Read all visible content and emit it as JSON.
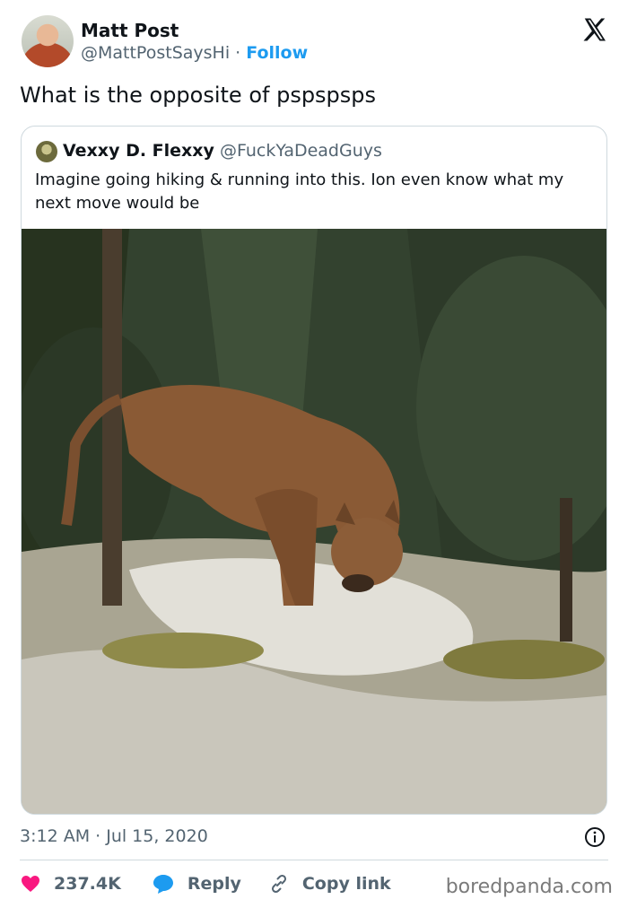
{
  "author": {
    "name": "Matt Post",
    "handle": "@MattPostSaysHi",
    "separator": "·",
    "follow_label": "Follow"
  },
  "tweet_text": "What is the opposite of pspspsps",
  "quoted": {
    "name": "Vexxy D. Flexxy",
    "handle": "@FuckYaDeadGuys",
    "text": "Imagine going hiking & running into this. Ion even know what my next move would be",
    "image_icon": "cougar-photo"
  },
  "timestamp": "3:12 AM · Jul 15, 2020",
  "actions": {
    "like_count": "237.4K",
    "reply_label": "Reply",
    "copy_label": "Copy link"
  },
  "watermark": "boredpanda.com",
  "colors": {
    "accent": "#1d9bf0",
    "like": "#f91880",
    "secondary_text": "#536471",
    "border": "#cfd9de"
  }
}
